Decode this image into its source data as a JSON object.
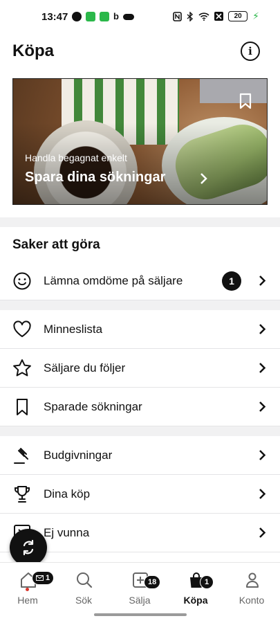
{
  "status_bar": {
    "time": "13:47",
    "battery": "20"
  },
  "header": {
    "title": "Köpa",
    "info_icon": "info-icon"
  },
  "hero": {
    "subtitle": "Handla begagnat enkelt",
    "title": "Spara dina sökningar"
  },
  "todo": {
    "heading": "Saker att göra",
    "review_label": "Lämna omdöme på säljare",
    "review_count": "1"
  },
  "lists": {
    "items": [
      {
        "label": "Minneslista",
        "icon": "heart-icon"
      },
      {
        "label": "Säljare du följer",
        "icon": "star-icon"
      },
      {
        "label": "Sparade sökningar",
        "icon": "bookmark-icon"
      },
      {
        "label": "Budgivningar",
        "icon": "gavel-icon"
      },
      {
        "label": "Dina köp",
        "icon": "trophy-icon"
      },
      {
        "label": "Ej vunna",
        "icon": "x-box-icon"
      }
    ]
  },
  "nav": {
    "items": [
      {
        "label": "Hem",
        "badge": "1"
      },
      {
        "label": "Sök"
      },
      {
        "label": "Sälja",
        "badge": "18"
      },
      {
        "label": "Köpa",
        "badge": "1"
      },
      {
        "label": "Konto"
      }
    ]
  },
  "colors": {
    "accent": "#111111",
    "status_green": "#2bb84a",
    "notification_red": "#d9342b",
    "divider": "#f1f1f2"
  }
}
